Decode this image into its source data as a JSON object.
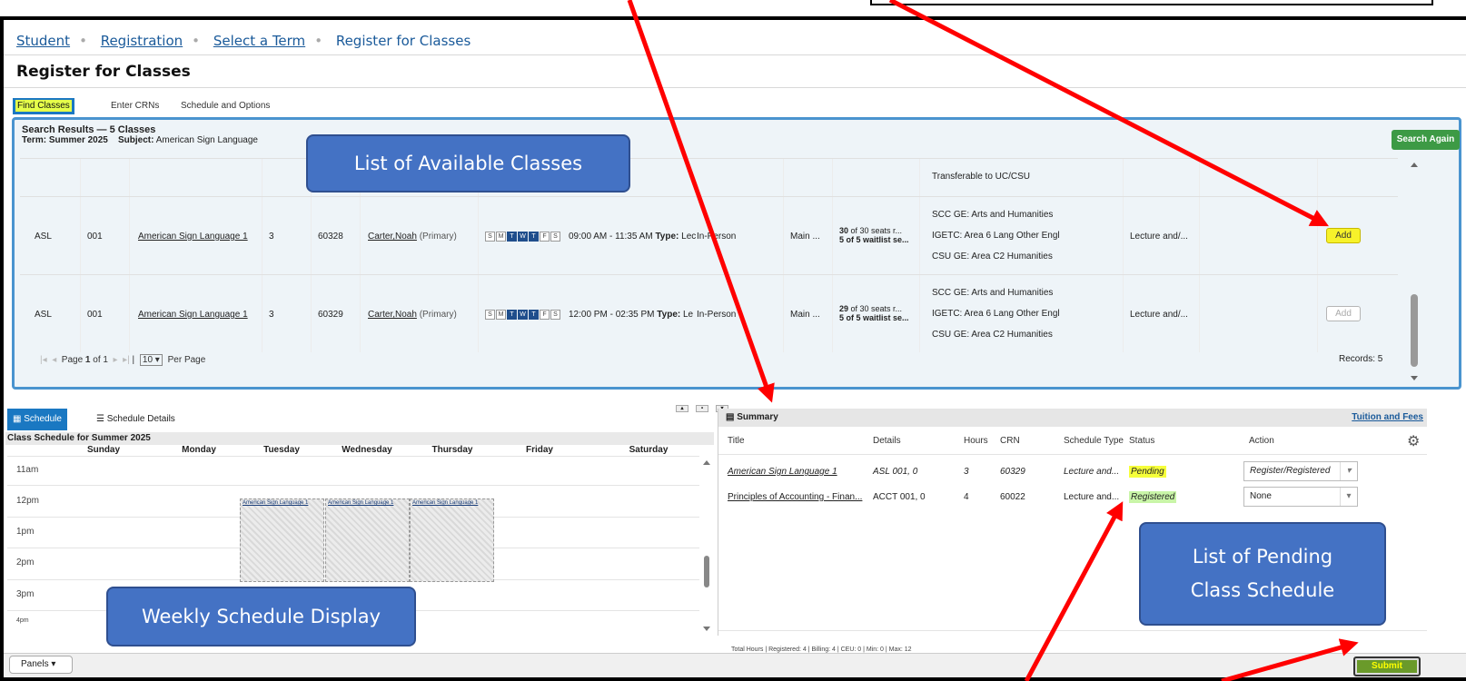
{
  "breadcrumb": {
    "items": [
      "Student",
      "Registration",
      "Select a Term"
    ],
    "current": "Register for Classes"
  },
  "page_title": "Register for Classes",
  "tabs": [
    "Find Classes",
    "Enter CRNs",
    "Schedule and Options"
  ],
  "search_results": {
    "title": "Search Results — 5 Classes",
    "term_label": "Term:",
    "term": "Summer 2025",
    "subject_label": "Subject:",
    "subject": "American Sign Language",
    "search_again": "Search Again",
    "partial_row_attribute": "Transferable to UC/CSU",
    "rows": [
      {
        "subject": "ASL",
        "course": "001",
        "title": "American Sign Language 1",
        "hours": "3",
        "crn": "60328",
        "instructor": "Carter,Noah",
        "instructor_role": "(Primary)",
        "days": [
          "S",
          "M",
          "T",
          "W",
          "T",
          "F",
          "S"
        ],
        "days_on": [
          false,
          false,
          true,
          true,
          true,
          false,
          false
        ],
        "time": "09:00 AM - 11:35 AM",
        "type_label": "Type:",
        "type_value": "Lec",
        "mode": "In-Person",
        "campus": "Main ...",
        "seats_num": "30",
        "seats_rest": "of 30 seats r...",
        "waitlist": "5 of 5 waitlist se...",
        "attributes": [
          "SCC GE: Arts and Humanities",
          "IGETC: Area 6 Lang Other Engl",
          "CSU GE: Area C2 Humanities"
        ],
        "schedule_type": "Lecture and/...",
        "add": "Add",
        "highlighted": true
      },
      {
        "subject": "ASL",
        "course": "001",
        "title": "American Sign Language 1",
        "hours": "3",
        "crn": "60329",
        "instructor": "Carter,Noah",
        "instructor_role": "(Primary)",
        "days": [
          "S",
          "M",
          "T",
          "W",
          "T",
          "F",
          "S"
        ],
        "days_on": [
          false,
          false,
          true,
          true,
          true,
          false,
          false
        ],
        "time": "12:00 PM - 02:35 PM",
        "type_label": "Type:",
        "type_value": "Le",
        "mode": "In-Person",
        "campus": "Main ...",
        "seats_num": "29",
        "seats_rest": "of 30 seats r...",
        "waitlist": "5 of 5 waitlist se...",
        "attributes": [
          "SCC GE: Arts and Humanities",
          "IGETC: Area 6 Lang Other Engl",
          "CSU GE: Area C2 Humanities"
        ],
        "schedule_type": "Lecture and/...",
        "add": "Add",
        "highlighted": false
      }
    ],
    "pager": {
      "page_label": "Page",
      "page": "1",
      "of_label": "of",
      "total": "1",
      "per_page_value": "10",
      "per_page_label": "Per Page"
    },
    "records": "Records: 5"
  },
  "schedule_panel": {
    "tabs": [
      "Schedule",
      "Schedule Details"
    ],
    "title": "Class Schedule for Summer 2025",
    "days": [
      "Sunday",
      "Monday",
      "Tuesday",
      "Wednesday",
      "Thursday",
      "Friday",
      "Saturday"
    ],
    "hours": [
      "11am",
      "12pm",
      "1pm",
      "2pm",
      "3pm",
      "4pm"
    ],
    "block_label": "American Sign Language 1"
  },
  "summary": {
    "title": "Summary",
    "tuition_link": "Tuition and Fees",
    "columns": [
      "Title",
      "Details",
      "Hours",
      "CRN",
      "Schedule Type",
      "Status",
      "Action"
    ],
    "rows": [
      {
        "title": "American Sign Language 1",
        "details": "ASL 001, 0",
        "hours": "3",
        "crn": "60329",
        "schedule_type": "Lecture and...",
        "status": "Pending",
        "action": "Register/Registered"
      },
      {
        "title": "Principles of Accounting - Finan...",
        "details": "ACCT 001, 0",
        "hours": "4",
        "crn": "60022",
        "schedule_type": "Lecture and...",
        "status": "Registered",
        "action": "None"
      }
    ],
    "totals": "Total Hours | Registered: 4 | Billing: 4 | CEU: 0 | Min: 0 | Max: 12"
  },
  "footer": {
    "panels": "Panels",
    "submit": "Submit"
  },
  "callouts": {
    "available": "List of Available Classes",
    "pending_line1": "List of Pending",
    "pending_line2": "Class Schedule",
    "weekly": "Weekly Schedule Display"
  },
  "colors": {
    "accent": "#1a78c2",
    "callout": "#4472c4",
    "arrow": "#ff0000",
    "highlight": "#f6ff3a",
    "registered": "#c9f5a8",
    "submit": "#6a9a2a"
  }
}
